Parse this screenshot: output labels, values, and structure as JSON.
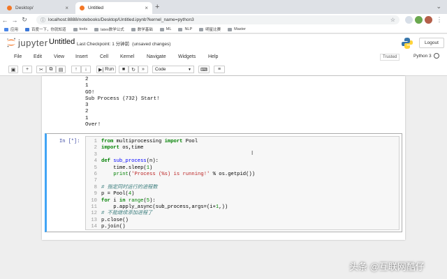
{
  "browser": {
    "tabs": [
      {
        "title": "Desktop/",
        "active": false
      },
      {
        "title": "Untitled",
        "active": true
      }
    ],
    "new_tab": "+",
    "url": "localhost:8888/notebooks/Desktop/Untitled.ipynb?kernel_name=python3",
    "bookmarks": [
      "应用",
      "百度一下，你就知道",
      "tools",
      "latex数学公式",
      "数学基础",
      "ML",
      "NLP",
      "明星比赛",
      "Master"
    ]
  },
  "jupyter": {
    "logo_text": "jupyter",
    "notebook_name": "Untitled",
    "checkpoint": "Last Checkpoint: 1 分钟前",
    "unsaved": "(unsaved changes)",
    "logout": "Logout",
    "trusted": "Trusted",
    "kernel": "Python 3"
  },
  "menu": [
    "File",
    "Edit",
    "View",
    "Insert",
    "Cell",
    "Kernel",
    "Navigate",
    "Widgets",
    "Help"
  ],
  "toolbar": {
    "run_label": "Run",
    "cell_type": "Code"
  },
  "output_lines": [
    "2",
    "1",
    "GO!",
    "Sub Process (732) Start!",
    "3",
    "2",
    "1",
    "Over!"
  ],
  "cell": {
    "prompt": "In [*]:",
    "lines": [
      "from multiprocessing import Pool",
      "import os,time",
      "",
      "def sub_process(n):",
      "    time.sleep(1)",
      "    print('Process (%s) is running!' % os.getpid())",
      "",
      "# 指定同时运行的进程数",
      "p = Pool(4)",
      "for i in range(5):",
      "    p.apply_async(sub_process,args=(i+1,))",
      "# 不能继续添加进程了",
      "p.close()",
      "p.join()"
    ]
  },
  "watermark": "头条 @互联网酷仔",
  "colors": {
    "accent": "#42a5f5",
    "keyword": "#008000",
    "comment": "#408080",
    "string": "#ba2121",
    "builtin": "#008000",
    "number": "#080",
    "defname": "#0000ff"
  }
}
